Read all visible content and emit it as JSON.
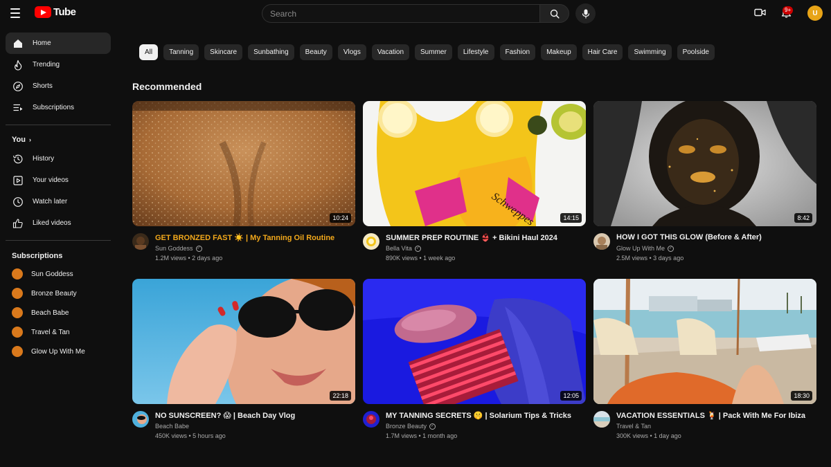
{
  "header": {
    "logo_text": "Tube",
    "search_placeholder": "Search",
    "notification_badge": "9+",
    "user_initial": "U",
    "user_color": "#e8a417"
  },
  "sidebar": {
    "main": [
      {
        "label": "Home",
        "icon": "home-icon",
        "active": true
      },
      {
        "label": "Trending",
        "icon": "flame-icon"
      },
      {
        "label": "Shorts",
        "icon": "compass-icon"
      },
      {
        "label": "Subscriptions",
        "icon": "subscriptions-icon"
      }
    ],
    "you_heading": "You",
    "you": [
      {
        "label": "History",
        "icon": "history-icon"
      },
      {
        "label": "Your videos",
        "icon": "your-videos-icon"
      },
      {
        "label": "Watch later",
        "icon": "clock-icon"
      },
      {
        "label": "Liked videos",
        "icon": "thumbs-up-icon"
      }
    ],
    "subs_heading": "Subscriptions",
    "subscriptions": [
      {
        "label": "Sun Goddess"
      },
      {
        "label": "Bronze Beauty"
      },
      {
        "label": "Beach Babe"
      },
      {
        "label": "Travel & Tan"
      },
      {
        "label": "Glow Up With Me"
      }
    ],
    "sub_dot_color": "#d9791c"
  },
  "chips": [
    "All",
    "Tanning",
    "Skincare",
    "Sunbathing",
    "Beauty",
    "Vlogs",
    "Vacation",
    "Summer",
    "Lifestyle",
    "Fashion",
    "Makeup",
    "Hair Care",
    "Swimming",
    "Poolside"
  ],
  "section_title": "Recommended",
  "videos": [
    {
      "title": "GET BRONZED FAST ☀️ | My Tanning Oil Routine",
      "channel": "Sun Goddess",
      "stats": "1.2M views • 2 days ago",
      "duration": "10:24",
      "highlighted": true
    },
    {
      "title": "SUMMER PREP ROUTINE 👙 + Bikini Haul 2024",
      "channel": "Bella Vita",
      "stats": "890K views • 1 week ago",
      "duration": "14:15"
    },
    {
      "title": "HOW I GOT THIS GLOW (Before & After)",
      "channel": "Glow Up With Me",
      "stats": "2.5M views • 3 days ago",
      "duration": "8:42"
    },
    {
      "title": "NO SUNSCREEN? 😱 | Beach Day Vlog",
      "channel": "Beach Babe",
      "stats": "450K views • 5 hours ago",
      "duration": "22:18"
    },
    {
      "title": "MY TANNING SECRETS 🤫 | Solarium Tips & Tricks",
      "channel": "Bronze Beauty",
      "stats": "1.7M views • 1 month ago",
      "duration": "12:05"
    },
    {
      "title": "VACATION ESSENTIALS 🍹 | Pack With Me For Ibiza",
      "channel": "Travel & Tan",
      "stats": "300K views • 1 day ago",
      "duration": "18:30"
    }
  ],
  "colors": {
    "background": "#0f0f0f",
    "chip": "#272727",
    "highlight_title": "#f2a81b",
    "brand_red": "#ff0000"
  }
}
